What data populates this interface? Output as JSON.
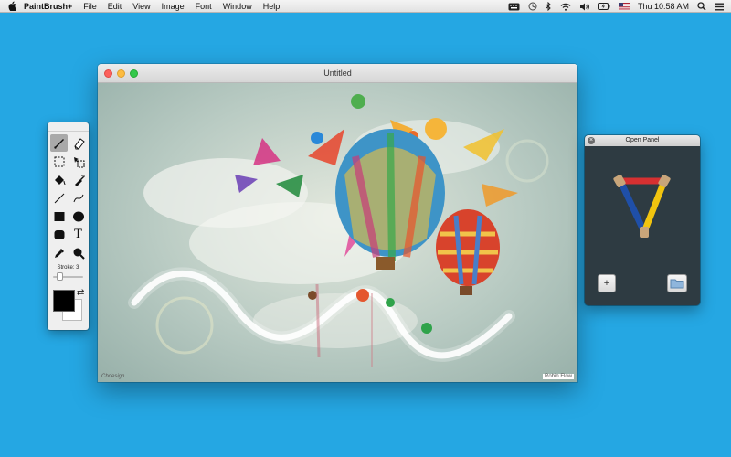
{
  "menubar": {
    "app_name": "PaintBrush+",
    "menus": [
      "File",
      "Edit",
      "View",
      "Image",
      "Font",
      "Window",
      "Help"
    ],
    "clock": "Thu 10:58 AM",
    "status_icons": [
      "keyboard-icon",
      "time-machine-icon",
      "bluetooth-icon",
      "wifi-icon",
      "volume-icon",
      "battery-icon",
      "flag-icon",
      "search-icon",
      "list-icon"
    ]
  },
  "canvas_window": {
    "title": "Untitled",
    "signature_left": "Cbdesign",
    "signature_right": "Robin Flow"
  },
  "tools": {
    "items": [
      "paintbrush-icon",
      "eraser-icon",
      "rectangle-select-icon",
      "move-icon",
      "fill-bucket-icon",
      "spray-icon",
      "line-icon",
      "curve-icon",
      "filled-rectangle-icon",
      "filled-ellipse-icon",
      "rounded-rectangle-icon",
      "text-icon",
      "eyedropper-icon",
      "zoom-icon"
    ],
    "text_tool_label": "T",
    "stroke_label": "Stroke: 3",
    "stroke_value": 3,
    "foreground_color": "#000000",
    "background_color": "#ffffff"
  },
  "open_panel": {
    "title": "Open Panel",
    "add_label": "+"
  },
  "colors": {
    "desktop": "#25a7e3",
    "panel": "#2e3b42"
  }
}
